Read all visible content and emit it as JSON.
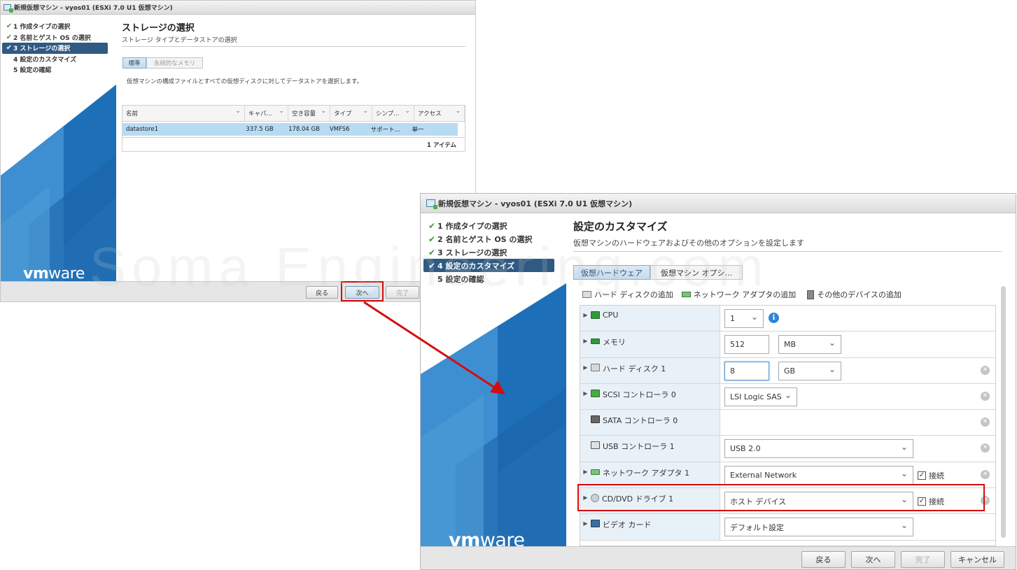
{
  "window1": {
    "title": "新規仮想マシン - vyos01 (ESXi 7.0 U1 仮想マシン)",
    "steps": [
      {
        "label": "1 作成タイプの選択",
        "done": true
      },
      {
        "label": "2 名前とゲスト OS の選択",
        "done": true
      },
      {
        "label": "3 ストレージの選択",
        "done": true,
        "active": true
      },
      {
        "label": "4 設定のカスタマイズ",
        "done": false
      },
      {
        "label": "5 設定の確認",
        "done": false
      }
    ],
    "page_title": "ストレージの選択",
    "page_subtitle": "ストレージ タイプとデータストアの選択",
    "tabs": [
      "標準",
      "永続的なメモリ"
    ],
    "description": "仮想マシンの構成ファイルとすべての仮想ディスクに対してデータストアを選択します。",
    "table": {
      "headers": [
        "名前",
        "キャパ...",
        "空き容量",
        "タイプ",
        "シンプ...",
        "アクセス"
      ],
      "rows": [
        [
          "datastore1",
          "337.5 GB",
          "178.04 GB",
          "VMFS6",
          "サポート...",
          "単一"
        ]
      ],
      "footer": "1 アイテム"
    },
    "buttons": {
      "back": "戻る",
      "next": "次へ",
      "finish": "完了"
    }
  },
  "window2": {
    "title": "新規仮想マシン - vyos01 (ESXi 7.0 U1 仮想マシン)",
    "steps": [
      {
        "label": "1 作成タイプの選択",
        "done": true
      },
      {
        "label": "2 名前とゲスト OS の選択",
        "done": true
      },
      {
        "label": "3 ストレージの選択",
        "done": true
      },
      {
        "label": "4 設定のカスタマイズ",
        "done": true,
        "active": true
      },
      {
        "label": "5 設定の確認",
        "done": false
      }
    ],
    "page_title": "設定のカスタマイズ",
    "page_subtitle": "仮想マシンのハードウェアおよびその他のオプションを設定します",
    "tabs": [
      "仮想ハードウェア",
      "仮想マシン オプシ..."
    ],
    "toolbar": {
      "add_disk": "ハード ディスクの追加",
      "add_nic": "ネットワーク アダプタの追加",
      "add_other": "その他のデバイスの追加"
    },
    "hardware": {
      "cpu": {
        "label": "CPU",
        "value": "1"
      },
      "memory": {
        "label": "メモリ",
        "value": "512",
        "unit": "MB"
      },
      "disk": {
        "label": "ハード ディスク 1",
        "value": "8",
        "unit": "GB"
      },
      "scsi": {
        "label": "SCSI コントローラ 0",
        "value": "LSI Logic SAS"
      },
      "sata": {
        "label": "SATA コントローラ 0"
      },
      "usb": {
        "label": "USB コントローラ 1",
        "value": "USB 2.0"
      },
      "nic": {
        "label": "ネットワーク アダプタ 1",
        "value": "External Network",
        "connect_label": "接続"
      },
      "cdrom": {
        "label": "CD/DVD ドライブ 1",
        "value": "ホスト デバイス",
        "connect_label": "接続"
      },
      "video": {
        "label": "ビデオ カード",
        "value": "デフォルト設定"
      }
    },
    "buttons": {
      "back": "戻る",
      "next": "次へ",
      "finish": "完了",
      "cancel": "キャンセル"
    }
  },
  "logo": {
    "vm": "vm",
    "ware": "ware"
  },
  "watermark": "Soma Engineering.com",
  "colors": {
    "active_step": "#2f5a83",
    "highlight_red": "#d40d0d",
    "brand_blue": "#1d6fb8",
    "check_green": "#3c9a3c"
  }
}
